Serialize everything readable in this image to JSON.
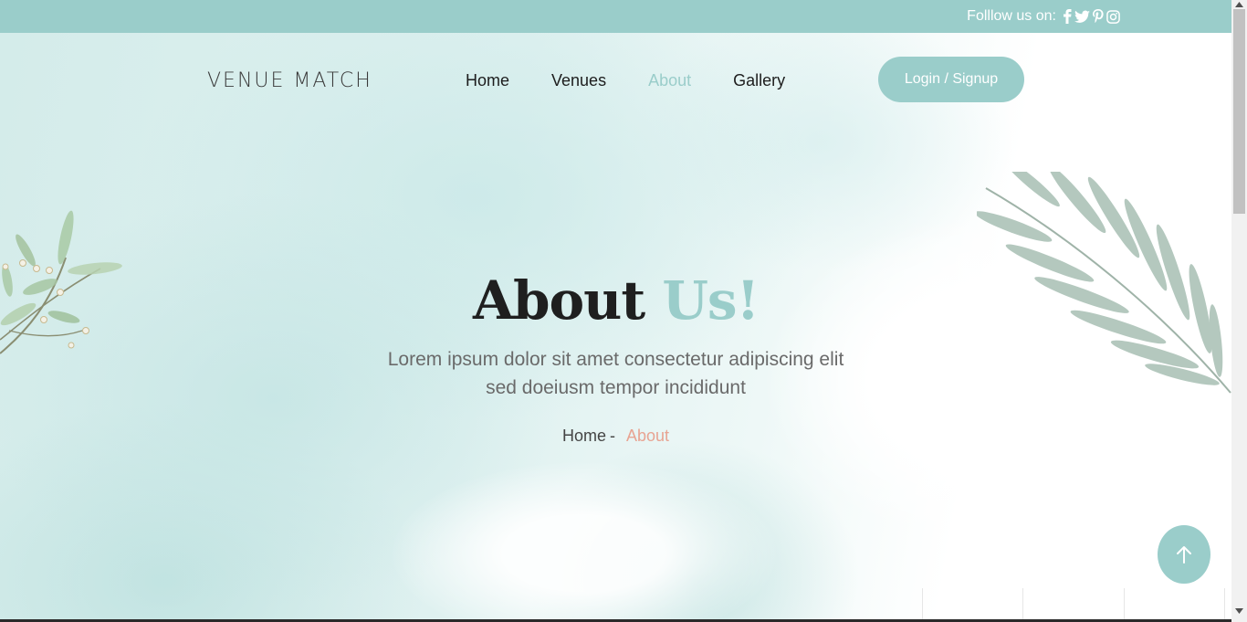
{
  "topbar": {
    "follow_label": "Folllow us on:",
    "social_icons": [
      "facebook-icon",
      "twitter-icon",
      "pinterest-icon",
      "instagram-icon"
    ]
  },
  "header": {
    "logo": "VENUE MATCH",
    "nav": [
      {
        "label": "Home",
        "active": false
      },
      {
        "label": "Venues",
        "active": false
      },
      {
        "label": "About",
        "active": true
      },
      {
        "label": "Gallery",
        "active": false
      }
    ],
    "login_label": "Login / Signup"
  },
  "hero": {
    "title_main": "About",
    "title_accent": "Us!",
    "subtitle_line1": "Lorem ipsum dolor sit amet consectetur adipiscing elit",
    "subtitle_line2": "sed doeiusm tempor incididunt",
    "breadcrumb": {
      "home": "Home",
      "separator": "-",
      "current": "About"
    }
  },
  "colors": {
    "accent": "#9acdca",
    "breadcrumb_current": "#e8a492",
    "text_dark": "#1f1f1f"
  }
}
